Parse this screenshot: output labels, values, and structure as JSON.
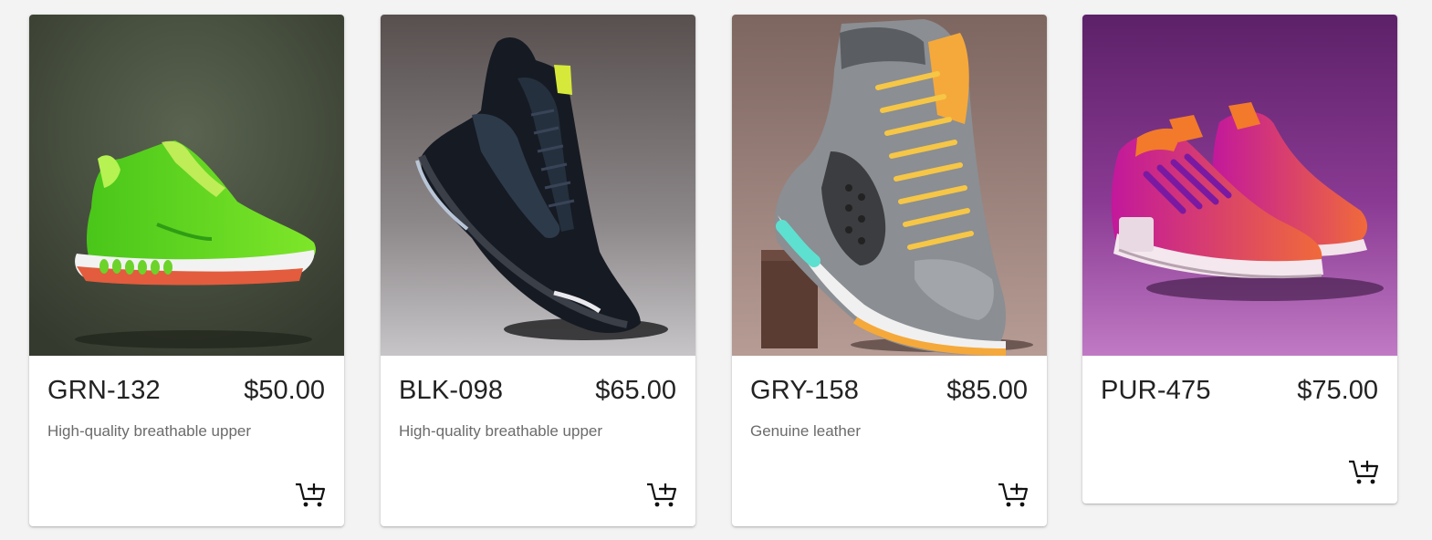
{
  "colors": {
    "page_bg": "#f3f3f3",
    "card_bg": "#ffffff",
    "text": "#222222",
    "muted_text": "#6b6b6b"
  },
  "products": [
    {
      "code": "GRN-132",
      "price": "$50.00",
      "description": "High-quality breathable upper",
      "image": "green-running-sneaker",
      "cart_icon": "add-to-cart-icon"
    },
    {
      "code": "BLK-098",
      "price": "$65.00",
      "description": "High-quality breathable upper",
      "image": "black-high-top-sneaker",
      "cart_icon": "add-to-cart-icon"
    },
    {
      "code": "GRY-158",
      "price": "$85.00",
      "description": "Genuine leather",
      "image": "gray-orange-boot",
      "cart_icon": "add-to-cart-icon"
    },
    {
      "code": "PUR-475",
      "price": "$75.00",
      "description": "",
      "image": "purple-sneaker-pair",
      "cart_icon": "add-to-cart-icon"
    }
  ]
}
